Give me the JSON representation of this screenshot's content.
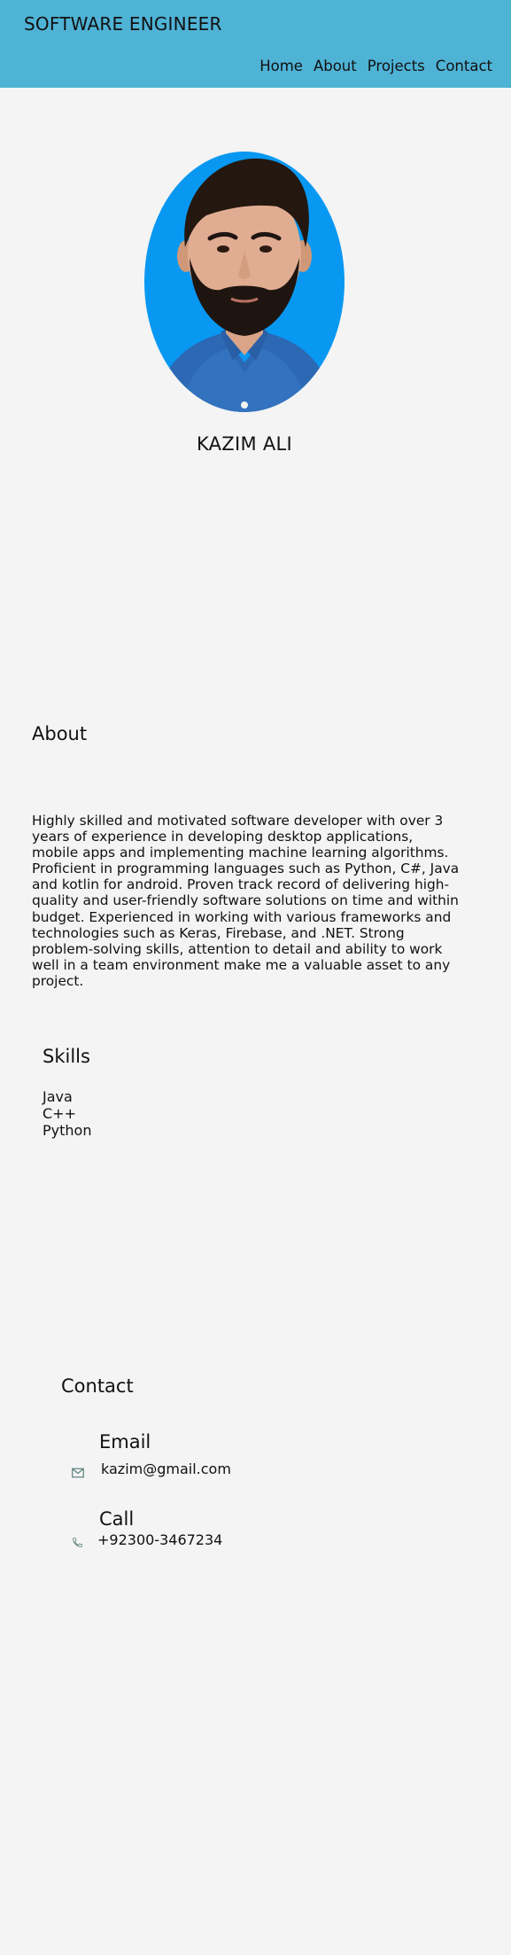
{
  "header": {
    "title": "SOFTWARE ENGINEER",
    "nav": [
      "Home",
      "About",
      "Projects",
      "Contact"
    ]
  },
  "profile": {
    "name": "KAZIM ALI"
  },
  "about": {
    "heading": "About",
    "text": "Highly skilled and motivated software developer with over 3 years of experience in developing desktop applications, mobile apps and implementing machine learning algorithms. Proficient in programming languages such as Python, C#, Java and kotlin for android. Proven track record of delivering high-quality and user-friendly software solutions on time and within budget. Experienced in working with various frameworks and technologies such as Keras, Firebase, and .NET. Strong problem-solving skills, attention to detail and ability to work well in a team environment make me a valuable asset to any project."
  },
  "skills": {
    "heading": "Skills",
    "items": [
      "Java",
      "C++",
      "Python"
    ]
  },
  "contact": {
    "heading": "Contact",
    "email_label": "Email",
    "email_value": "kazim@gmail.com",
    "email_icon": "envelope-icon",
    "call_label": "Call",
    "call_value": "+92300-3467234",
    "call_icon": "phone-icon"
  },
  "colors": {
    "header_bg": "#4fb3d6",
    "page_bg": "#f4f4f4",
    "portrait_bg": "#0898f2"
  }
}
